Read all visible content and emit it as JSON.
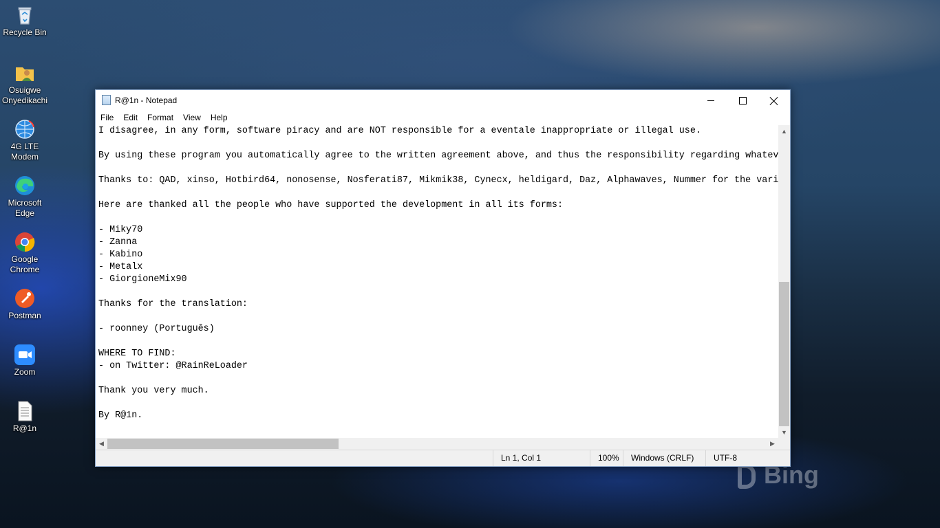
{
  "desktop": {
    "icons": [
      {
        "label": "Recycle Bin",
        "icon": "recycle-bin-icon"
      },
      {
        "label": "Osuigwe Onyedikachi",
        "icon": "user-folder-icon"
      },
      {
        "label": "4G LTE Modem",
        "icon": "globe-icon"
      },
      {
        "label": "Microsoft Edge",
        "icon": "edge-icon"
      },
      {
        "label": "Google Chrome",
        "icon": "chrome-icon"
      },
      {
        "label": "Postman",
        "icon": "postman-icon"
      },
      {
        "label": "Zoom",
        "icon": "zoom-icon"
      },
      {
        "label": "R@1n",
        "icon": "text-file-icon"
      }
    ],
    "watermark": "Bing"
  },
  "window": {
    "title": "R@1n - Notepad",
    "menu": [
      "File",
      "Edit",
      "Format",
      "View",
      "Help"
    ],
    "content": "I disagree, in any form, software piracy and are NOT responsible for a eventale inappropriate or illegal use.\n\nBy using these program you automatically agree to the written agreement above, and thus the responsibility regarding whatev\n\nThanks to: QAD, xinso, Hotbird64, nonosense, Nosferati87, Mikmik38, Cynecx, heldigard, Daz, Alphawaves, Nummer for the vari\n\nHere are thanked all the people who have supported the development in all its forms:\n\n- Miky70\n- Zanna\n- Kabino\n- Metalx\n- GiorgioneMix90\n\nThanks for the translation:\n\n- roonney (Português)\n\nWHERE TO FIND:\n- on Twitter: @RainReLoader\n\nThank you very much.\n\nBy R@1n.",
    "status": {
      "position": "Ln 1, Col 1",
      "zoom": "100%",
      "line_endings": "Windows (CRLF)",
      "encoding": "UTF-8"
    }
  },
  "colors": {
    "window_border": "#8aa5c8",
    "scroll_thumb": "#c2c2c2",
    "statusbar_bg": "#f0f0f0"
  }
}
